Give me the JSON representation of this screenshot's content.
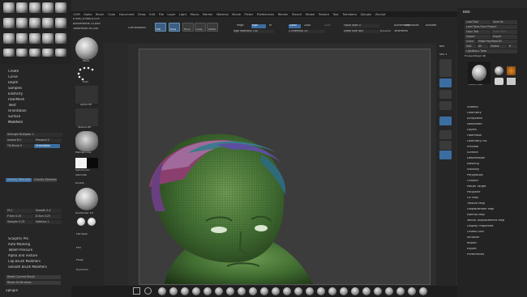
{
  "app": {
    "menu": [
      "GVM",
      "Alpha",
      "Brush",
      "Color",
      "Document",
      "Draw",
      "Edit",
      "File",
      "Layer",
      "Light",
      "Macro",
      "Marker",
      "Material",
      "Movie",
      "Picker",
      "Preferences",
      "Render",
      "Stencil",
      "Stroke",
      "Texture",
      "Tool",
      "Transform",
      "Zplugin",
      "Zscript"
    ]
  },
  "info": {
    "dims": "0.494,-0.066,0.519",
    "active_points": "ActivePoints 10,646",
    "total_points": "TotalPoints 56,056",
    "live_boolean": "Live Boolean"
  },
  "draw_controls": {
    "edit_label": "Edit",
    "draw_label": "Draw",
    "move_label": "Move",
    "scale_label": "Scale",
    "rotate_label": "Rotate",
    "mrgb_label": "Mrgb",
    "rgb_label": "Rgb",
    "m_label": "M",
    "rgb_intensity": "Rgb Intensity 100",
    "zadd_label": "Zadd",
    "zsub_label": "Zsub",
    "zcut_label": "Zcut",
    "z_intensity": "Z Intensity 25",
    "focal_shift": "Focal Shift 0",
    "draw_size": "Draw Size 485",
    "dynamic_label": "Dynamic",
    "active_points_r": "ActivePoints",
    "total_points_r": "TotalPoints",
    "lazymouse": "LazyMouse",
    "activate_symmetry": "Activate Symmetry"
  },
  "left_menu": {
    "items": [
      "Create",
      "Curve",
      "Depth",
      "Samples",
      "Elasticity",
      "FiberMesh",
      "Twist",
      "Orientation",
      "Surface",
      "Modifiers"
    ],
    "sliders": [
      "Strength Multiplier 1",
      "Inward N 0",
      "Pressure 0",
      "Tilt Brush 0",
      "Orientation"
    ],
    "sliders2": [
      "Gravity Strength 0",
      "Gravity Direction"
    ],
    "bottom_items": [
      "Sculptris Pro",
      "Auto Masking",
      "Tablet Pressure",
      "Alpha and Texture",
      "Clip Brush Modifiers",
      "Smooth Brush Modifiers"
    ],
    "footer_buttons": [
      "Reset Current Brush",
      "Reset All Brushes"
    ],
    "zplugin": "Zplugin",
    "small_sliders": [
      "Fit 1",
      "Smooth 0.4",
      "P Ann 0.25",
      "D Ann 0.25",
      "Sampler 0.25",
      "Softness 1"
    ]
  },
  "left_shelf": {
    "labels": [
      "Move",
      "Dots",
      "Alpha Off",
      "Texture Off",
      "MatCap Gray",
      "Gradient",
      "SwitchColor",
      "Alternate",
      "Double",
      "OneShader 0.2",
      "Flat Mesh",
      "FFH ",
      "FSeek",
      "Dynamics"
    ]
  },
  "right_panel": {
    "title": "Tool",
    "buttons": [
      "Load Tool",
      "Save As",
      "Load Tools From Project",
      "Copy Tool",
      "Paste Tool",
      "Import",
      "Export",
      "Clone",
      "Make PolyMesh3D",
      "GoZ",
      "All",
      "Visible",
      "R"
    ],
    "lightbox": "Lightbox ▸ Tools",
    "subtool_label": "Forward/Head 48",
    "thumbs": [
      "Forward Head",
      "Sphere3D",
      "SimpleBrush",
      "Cylinder3D",
      "PM3D_Cube"
    ],
    "items": [
      "Subtool",
      "Geometry",
      "ArrayMesh",
      "NanoMesh",
      "Layers",
      "FiberMesh",
      "Geometry HD",
      "Preview",
      "Surface",
      "Deformation",
      "Masking",
      "Visibility",
      "Polygroups",
      "Contact",
      "Morph Target",
      "Polypaint",
      "UV Map",
      "Texture Map",
      "Displacement Map",
      "Normal Map",
      "Vector Displacement Map",
      "Display Properties",
      "Unified Skin",
      "Initialize",
      "Import",
      "Export",
      "Preferences"
    ]
  },
  "right_shelf": {
    "labels": [
      "BPR",
      "SPix 3",
      "Scroll",
      "Zoom",
      "Actual",
      "AAHalf",
      "Persp",
      "Floor",
      "Local",
      "L.Sym",
      "Frame",
      "Move",
      "Scale",
      "Rotate",
      "Line Fill",
      "PolyF",
      "Transp",
      "Ghost",
      "Solo",
      "Xpose"
    ]
  },
  "colors": {
    "accent": "#3b6ea0",
    "skin": "#4c7a3c",
    "background": "#2a2a2a"
  }
}
